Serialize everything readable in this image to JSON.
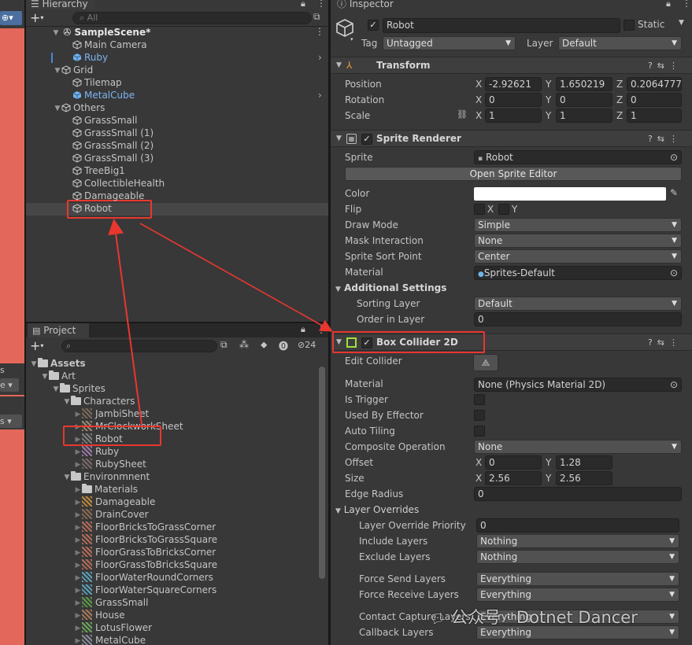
{
  "hierarchy": {
    "tab": "Hierarchy",
    "search_placeholder": "All",
    "scene": "SampleScene*",
    "items": [
      "Main Camera",
      "Ruby",
      "Grid",
      "Tilemap",
      "MetalCube",
      "Others",
      "GrassSmall",
      "GrassSmall (1)",
      "GrassSmall (2)",
      "GrassSmall (3)",
      "TreeBig1",
      "CollectibleHealth",
      "Damageable",
      "Robot"
    ]
  },
  "project": {
    "tab": "Project",
    "hidden_count": "24",
    "tree": [
      "Assets",
      "Art",
      "Sprites",
      "Characters",
      "JambiSheet",
      "MrClockworkSheet",
      "Robot",
      "Ruby",
      "RubySheet",
      "Environmnent",
      "Materials",
      "Damageable",
      "DrainCover",
      "FloorBricksToGrassCorner",
      "FloorBricksToGrassSquare",
      "FloorGrassToBricksCorner",
      "FloorGrassToBricksSquare",
      "FloorWaterRoundCorners",
      "FloorWaterSquareCorners",
      "GrassSmall",
      "House",
      "LotusFlower",
      "MetalCube"
    ]
  },
  "left_strip": {
    "s1": "s",
    "s2": "e",
    "s3": "s"
  },
  "inspector": {
    "tab": "Inspector",
    "object_name": "Robot",
    "static_label": "Static",
    "tag_label": "Tag",
    "tag_value": "Untagged",
    "layer_label": "Layer",
    "layer_value": "Default",
    "transform": {
      "title": "Transform",
      "position_label": "Position",
      "rotation_label": "Rotation",
      "scale_label": "Scale",
      "x": "X",
      "y": "Y",
      "z": "Z",
      "pos_x": "-2.92621",
      "pos_y": "1.650219",
      "pos_z": "0.2064777",
      "rot_x": "0",
      "rot_y": "0",
      "rot_z": "0",
      "scl_x": "1",
      "scl_y": "1",
      "scl_z": "1"
    },
    "sprite_renderer": {
      "title": "Sprite Renderer",
      "sprite_label": "Sprite",
      "sprite_value": "Robot",
      "open_editor": "Open Sprite Editor",
      "color_label": "Color",
      "flip_label": "Flip",
      "flip_x": "X",
      "flip_y": "Y",
      "draw_mode_label": "Draw Mode",
      "draw_mode": "Simple",
      "mask_label": "Mask Interaction",
      "mask_value": "None",
      "sort_point_label": "Sprite Sort Point",
      "sort_point": "Center",
      "material_label": "Material",
      "material_value": "Sprites-Default",
      "additional": "Additional Settings",
      "sorting_layer_label": "Sorting Layer",
      "sorting_layer": "Default",
      "order_label": "Order in Layer",
      "order_value": "0"
    },
    "box_collider": {
      "title": "Box Collider 2D",
      "edit_label": "Edit Collider",
      "material_label": "Material",
      "material_value": "None (Physics Material 2D)",
      "trigger_label": "Is Trigger",
      "effector_label": "Used By Effector",
      "tiling_label": "Auto Tiling",
      "composite_label": "Composite Operation",
      "composite_value": "None",
      "offset_label": "Offset",
      "off_x": "0",
      "off_y": "1.28",
      "size_label": "Size",
      "size_x": "2.56",
      "size_y": "2.56",
      "edge_label": "Edge Radius",
      "edge_value": "0",
      "overrides": "Layer Overrides",
      "priority_label": "Layer Override Priority",
      "priority_value": "0",
      "include_label": "Include Layers",
      "include_value": "Nothing",
      "exclude_label": "Exclude Layers",
      "exclude_value": "Nothing",
      "force_send_label": "Force Send Layers",
      "force_send_value": "Everything",
      "force_recv_label": "Force Receive Layers",
      "force_recv_value": "Everything",
      "contact_label": "Contact Capture Layers",
      "contact_value": "Everything",
      "callback_label": "Callback Layers",
      "callback_value": "Everything"
    }
  },
  "watermark": "公众号 · Dotnet Dancer",
  "colors": {
    "highlight": "#e8372f",
    "prefab_blue": "#7cb4f0",
    "panel": "#383838",
    "scene_red": "#e3675a"
  }
}
